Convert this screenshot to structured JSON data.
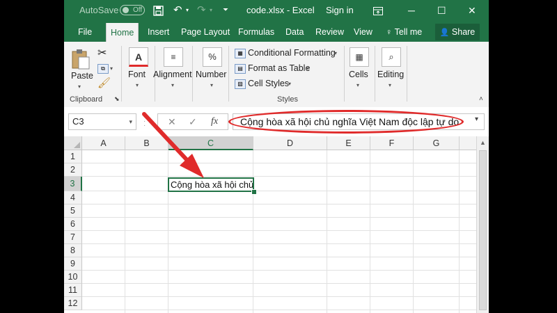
{
  "titlebar": {
    "autosave_label": "AutoSave",
    "autosave_state": "Off",
    "filename": "code.xlsx",
    "separator": "-",
    "app": "Excel",
    "signin": "Sign in"
  },
  "tabs": [
    {
      "label": "File"
    },
    {
      "label": "Home"
    },
    {
      "label": "Insert"
    },
    {
      "label": "Page Layout"
    },
    {
      "label": "Formulas"
    },
    {
      "label": "Data"
    },
    {
      "label": "Review"
    },
    {
      "label": "View"
    },
    {
      "label": "Tell me"
    }
  ],
  "share_label": "Share",
  "ribbon": {
    "paste": "Paste",
    "clipboard": "Clipboard",
    "font": "Font",
    "alignment": "Alignment",
    "number": "Number",
    "conditional_formatting": "Conditional Formatting",
    "format_as_table": "Format as Table",
    "cell_styles": "Cell Styles",
    "styles": "Styles",
    "cells": "Cells",
    "editing": "Editing"
  },
  "formula_bar": {
    "name_box": "C3",
    "fx": "fx",
    "content": "Cộng hòa xã hội chủ nghĩa Việt Nam độc lập tự do"
  },
  "grid": {
    "columns": [
      "A",
      "B",
      "C",
      "D",
      "E",
      "F",
      "G"
    ],
    "rows": [
      "1",
      "2",
      "3",
      "4",
      "5",
      "6",
      "7",
      "8",
      "9",
      "10",
      "11",
      "12"
    ],
    "active_cell_text": "Cộng hòa xã hội chủ"
  },
  "colors": {
    "brand_green": "#217346",
    "annotation_red": "#e02b2b"
  }
}
